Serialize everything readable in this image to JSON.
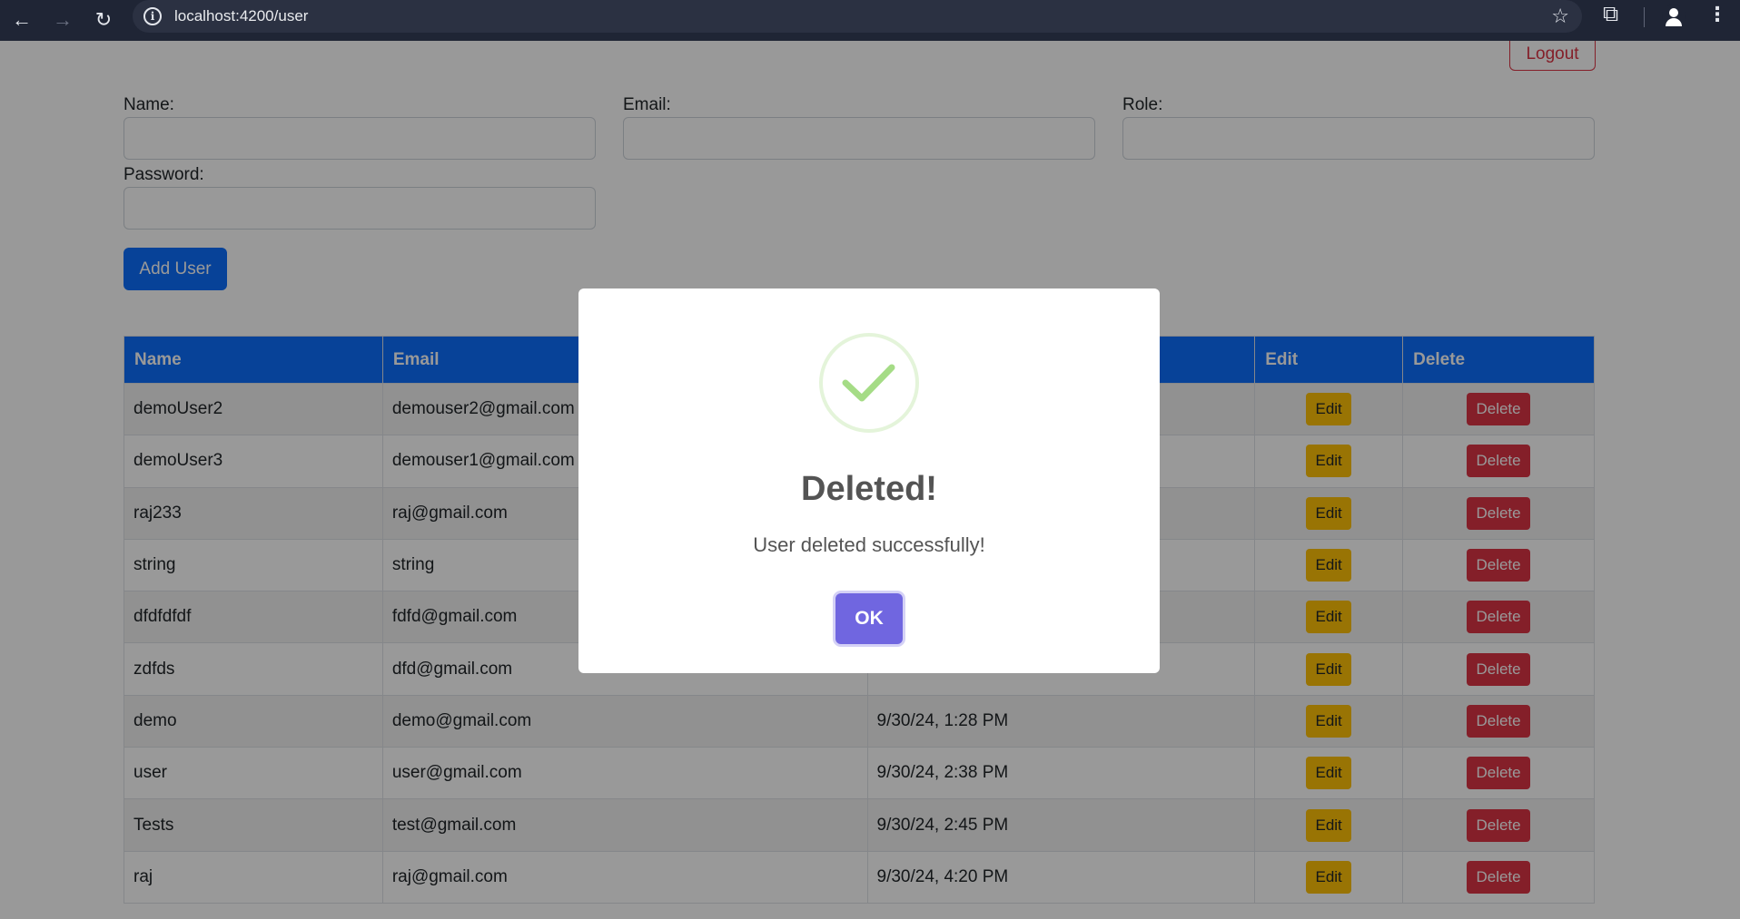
{
  "browser": {
    "url": "localhost:4200/user",
    "icons": [
      "back-arrow-icon",
      "forward-arrow-icon",
      "reload-icon",
      "info-icon",
      "star-icon",
      "extensions-icon",
      "profile-icon",
      "menu-icon"
    ]
  },
  "header": {
    "logout_label": "Logout"
  },
  "form": {
    "name_label": "Name:",
    "email_label": "Email:",
    "role_label": "Role:",
    "password_label": "Password:",
    "name_value": "",
    "email_value": "",
    "role_value": "",
    "password_value": "",
    "add_button": "Add User"
  },
  "table": {
    "headers": {
      "name": "Name",
      "email": "Email",
      "created": "",
      "edit": "Edit",
      "delete": "Delete"
    },
    "rows": [
      {
        "name": "demoUser2",
        "email": "demouser2@gmail.com",
        "created": "",
        "edit": "Edit",
        "delete": "Delete"
      },
      {
        "name": "demoUser3",
        "email": "demouser1@gmail.com",
        "created": "",
        "edit": "Edit",
        "delete": "Delete"
      },
      {
        "name": "raj233",
        "email": "raj@gmail.com",
        "created": "",
        "edit": "Edit",
        "delete": "Delete"
      },
      {
        "name": "string",
        "email": "string",
        "created": "",
        "edit": "Edit",
        "delete": "Delete"
      },
      {
        "name": "dfdfdfdf",
        "email": "fdfd@gmail.com",
        "created": "",
        "edit": "Edit",
        "delete": "Delete"
      },
      {
        "name": "zdfds",
        "email": "dfd@gmail.com",
        "created": "",
        "edit": "Edit",
        "delete": "Delete"
      },
      {
        "name": "demo",
        "email": "demo@gmail.com",
        "created": "9/30/24, 1:28 PM",
        "edit": "Edit",
        "delete": "Delete"
      },
      {
        "name": "user",
        "email": "user@gmail.com",
        "created": "9/30/24, 2:38 PM",
        "edit": "Edit",
        "delete": "Delete"
      },
      {
        "name": "Tests",
        "email": "test@gmail.com",
        "created": "9/30/24, 2:45 PM",
        "edit": "Edit",
        "delete": "Delete"
      },
      {
        "name": "raj",
        "email": "raj@gmail.com",
        "created": "9/30/24, 4:20 PM",
        "edit": "Edit",
        "delete": "Delete"
      }
    ]
  },
  "dialog": {
    "icon": "success-check-icon",
    "title": "Deleted!",
    "message": "User deleted successfully!",
    "ok_label": "OK"
  },
  "colors": {
    "primary": "#0d6efd",
    "edit": "#ffc107",
    "delete": "#dc3545",
    "confirm": "#7066e0",
    "success": "#a5dc86"
  }
}
